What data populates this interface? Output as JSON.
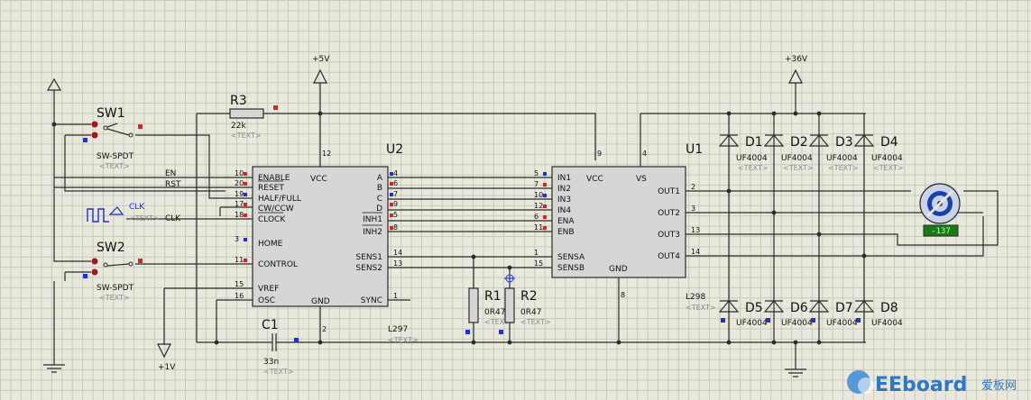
{
  "components": {
    "u2": {
      "ref": "U2",
      "part": "L297",
      "text": "<TEXT>",
      "pins_left": [
        "ENABLE",
        "RESET",
        "HALF/FULL",
        "CW/CCW",
        "CLOCK",
        "HOME",
        "CONTROL",
        "VREF",
        "OSC"
      ],
      "pins_left_nums": [
        "10",
        "20",
        "19",
        "17",
        "18",
        "3",
        "11",
        "15",
        "16"
      ],
      "pins_right": [
        "A",
        "B",
        "C",
        "D",
        "INH1",
        "INH2",
        "SENS1",
        "SENS2",
        "SYNC"
      ],
      "pins_right_nums": [
        "4",
        "6",
        "7",
        "9",
        "5",
        "8",
        "14",
        "13",
        "1"
      ],
      "vcc": "VCC",
      "gnd": "GND",
      "vcc_pin": "12",
      "gnd_pin": "2"
    },
    "u1": {
      "ref": "U1",
      "part": "L298",
      "text": "<TEXT>",
      "pins_left": [
        "IN1",
        "IN2",
        "IN3",
        "IN4",
        "ENA",
        "ENB",
        "SENSA",
        "SENSB"
      ],
      "pins_left_nums": [
        "5",
        "7",
        "10",
        "12",
        "6",
        "11",
        "1",
        "15"
      ],
      "pins_right": [
        "OUT1",
        "OUT2",
        "OUT3",
        "OUT4"
      ],
      "pins_right_nums": [
        "2",
        "3",
        "13",
        "14"
      ],
      "vcc": "VCC",
      "vs": "VS",
      "gnd": "GND",
      "vcc_pin": "9",
      "vs_pin": "4",
      "gnd_pin": "8"
    },
    "r3": {
      "ref": "R3",
      "value": "22k",
      "text": "<TEXT>"
    },
    "r1": {
      "ref": "R1",
      "value": "0R47",
      "text": "<TEXT>"
    },
    "r2": {
      "ref": "R2",
      "value": "0R47",
      "text": "<TEXT>"
    },
    "c1": {
      "ref": "C1",
      "value": "33n",
      "text": "<TEXT>"
    },
    "sw1": {
      "ref": "SW1",
      "part": "SW-SPDT",
      "text": "<TEXT>"
    },
    "sw2": {
      "ref": "SW2",
      "part": "SW-SPDT",
      "text": "<TEXT>"
    },
    "clk": {
      "label": "CLK",
      "text": "<TEXT>",
      "net": "CLK"
    },
    "diodes": [
      {
        "ref": "D1",
        "part": "UF4004",
        "text": "<TEXT>"
      },
      {
        "ref": "D2",
        "part": "UF4004",
        "text": "<TEXT>"
      },
      {
        "ref": "D3",
        "part": "UF4004",
        "text": "<TEXT>"
      },
      {
        "ref": "D4",
        "part": "UF4004",
        "text": "<TEXT>"
      },
      {
        "ref": "D5",
        "part": "UF4004",
        "text": "<TEXT>"
      },
      {
        "ref": "D6",
        "part": "UF4004",
        "text": "<TEXT>"
      },
      {
        "ref": "D7",
        "part": "UF4004",
        "text": "<TEXT>"
      },
      {
        "ref": "D8",
        "part": "UF4004",
        "text": "<TEXT>"
      }
    ],
    "motor": {
      "readout": "-137"
    }
  },
  "power": {
    "v5": "+5V",
    "v36": "+36V",
    "v1": "+1V"
  },
  "nets": {
    "en": "EN",
    "rst": "RST"
  },
  "watermark": {
    "brand": "EEboard",
    "suffix": "爱板网"
  },
  "colors": {
    "background": "#e8e8dc",
    "grid": "#c9c9bb",
    "wire": "#2b2b2b",
    "chip": "#d6d6d6",
    "marker_red": "#e02020",
    "marker_blue": "#2030e0",
    "readout_bg": "#1a7a1a",
    "readout_fg": "#b6ff9a"
  }
}
